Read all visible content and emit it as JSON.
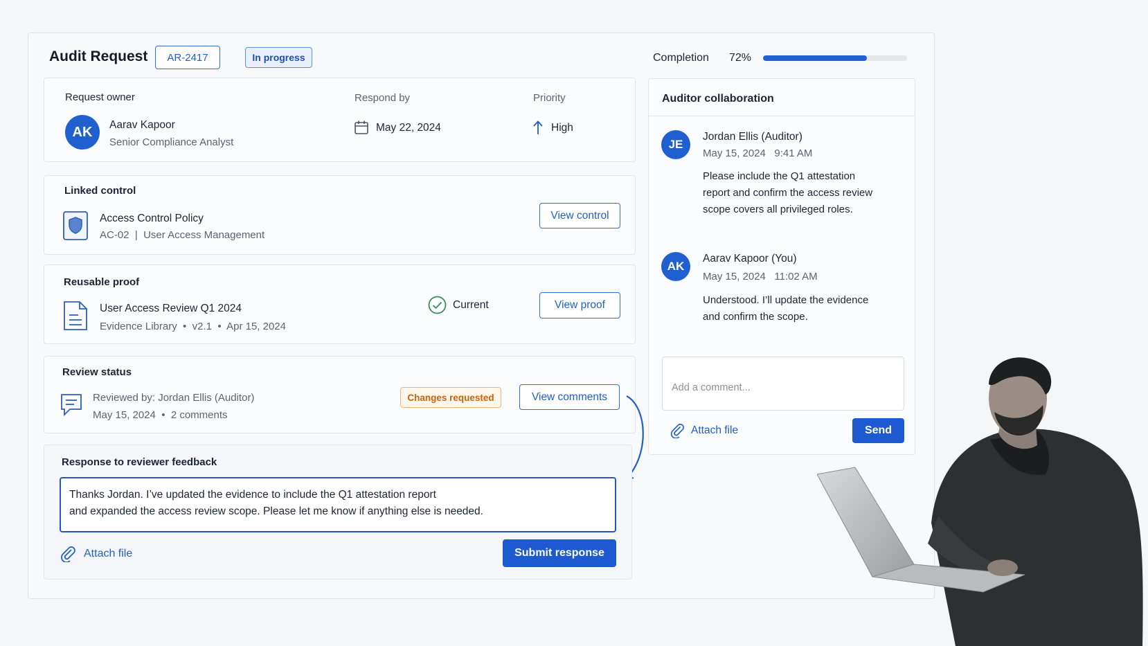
{
  "header": {
    "title": "Audit Request",
    "request_id": "AR-2417",
    "status": "In progress",
    "completion_label": "Completion",
    "completion_value": "72%",
    "completion_fraction": 0.72
  },
  "owner_card": {
    "owner_label": "Request owner",
    "owner_initials": "AK",
    "owner_name": "Aarav Kapoor",
    "owner_role": "Senior Compliance Analyst",
    "respond_label": "Respond by",
    "respond_date": "May 22, 2024",
    "priority_label": "Priority",
    "priority_value": "High"
  },
  "linked_control": {
    "section_label": "Linked control",
    "name": "Access Control Policy",
    "meta": "AC-02  |  User Access Management",
    "button": "View control"
  },
  "reusable_proof": {
    "section_label": "Reusable proof",
    "name": "User Access Review Q1 2024",
    "meta": "Evidence Library  •  v2.1  •  Apr 15, 2024",
    "status": "Current",
    "button": "View proof"
  },
  "review_status": {
    "section_label": "Review status",
    "reviewed_by": "Reviewed by: Jordan Ellis (Auditor)",
    "meta": "May 15, 2024  •  2 comments",
    "badge": "Changes requested",
    "button": "View comments"
  },
  "response": {
    "section_label": "Response to reviewer feedback",
    "text_line1": "Thanks Jordan. I’ve updated the evidence to include the Q1 attestation report",
    "text_line2": "and expanded the access review scope. Please let me know if anything else is needed.",
    "attach": "Attach file",
    "submit": "Submit response"
  },
  "collaboration": {
    "title": "Auditor collaboration",
    "messages": [
      {
        "initials": "JE",
        "author": "Jordan Ellis (Auditor)",
        "timestamp": "May 15, 2024   9:41 AM",
        "lines": [
          "Please include the Q1 attestation",
          "report and confirm the access review",
          "scope covers all privileged roles."
        ]
      },
      {
        "initials": "AK",
        "author": "Aarav Kapoor (You)",
        "timestamp": "May 15, 2024   11:02 AM",
        "lines": [
          "Understood. I’ll update the evidence",
          "and confirm the scope."
        ]
      }
    ],
    "input_placeholder": "Add a comment...",
    "attach": "Attach file",
    "send": "Send"
  },
  "colors": {
    "accent": "#1d5ad1",
    "warning": "#c8620f",
    "success": "#3f8a5c"
  }
}
